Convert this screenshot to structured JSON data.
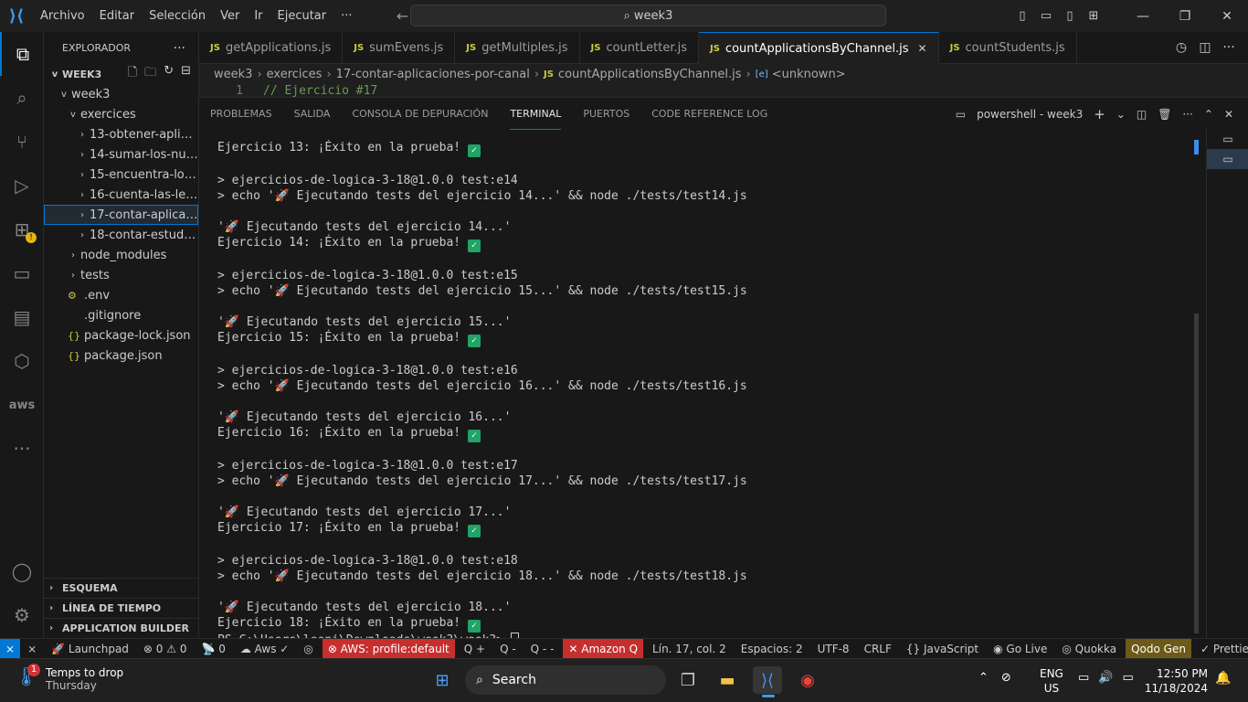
{
  "window": {
    "search_text": "week3"
  },
  "menu": [
    "Archivo",
    "Editar",
    "Selección",
    "Ver",
    "Ir",
    "Ejecutar",
    "···"
  ],
  "sidebar": {
    "title": "EXPLORADOR",
    "root": "WEEK3",
    "items": [
      {
        "label": "week3",
        "indent": 1,
        "chevron": "v"
      },
      {
        "label": "exercices",
        "indent": 2,
        "chevron": "v"
      },
      {
        "label": "13-obtener-aplicac...",
        "indent": 3,
        "chevron": ">"
      },
      {
        "label": "14-sumar-los-num...",
        "indent": 3,
        "chevron": ">"
      },
      {
        "label": "15-encuentra-los-...",
        "indent": 3,
        "chevron": ">"
      },
      {
        "label": "16-cuenta-las-letras",
        "indent": 3,
        "chevron": ">"
      },
      {
        "label": "17-contar-aplicaci...",
        "indent": 3,
        "chevron": ">",
        "selected": true
      },
      {
        "label": "18-contar-estudian...",
        "indent": 3,
        "chevron": ">"
      },
      {
        "label": "node_modules",
        "indent": 2,
        "chevron": ">"
      },
      {
        "label": "tests",
        "indent": 2,
        "chevron": ">"
      },
      {
        "label": ".env",
        "indent": 2,
        "chevron": "",
        "icon": "⚙"
      },
      {
        "label": ".gitignore",
        "indent": 2,
        "chevron": "",
        "icon": ""
      },
      {
        "label": "package-lock.json",
        "indent": 2,
        "chevron": "",
        "icon": "{}"
      },
      {
        "label": "package.json",
        "indent": 2,
        "chevron": "",
        "icon": "{}"
      }
    ],
    "sections": [
      "ESQUEMA",
      "LÍNEA DE TIEMPO",
      "APPLICATION BUILDER"
    ]
  },
  "tabs": [
    {
      "label": "getApplications.js"
    },
    {
      "label": "sumEvens.js"
    },
    {
      "label": "getMultiples.js"
    },
    {
      "label": "countLetter.js"
    },
    {
      "label": "countApplicationsByChannel.js",
      "active": true
    },
    {
      "label": "countStudents.js"
    }
  ],
  "breadcrumb": [
    "week3",
    "exercices",
    "17-contar-aplicaciones-por-canal",
    "countApplicationsByChannel.js",
    "<unknown>"
  ],
  "editor": {
    "line_number": "1",
    "line_text": "// Ejercicio #17"
  },
  "panel": {
    "tabs": [
      "PROBLEMAS",
      "SALIDA",
      "CONSOLA DE DEPURACIÓN",
      "TERMINAL",
      "PUERTOS",
      "CODE REFERENCE LOG"
    ],
    "active_tab": "TERMINAL",
    "terminal_name": "powershell - week3"
  },
  "terminal": {
    "lines": [
      {
        "text": "Ejercicio 13: ¡Éxito en la prueba! ",
        "check": true
      },
      {
        "text": ""
      },
      {
        "text": "> ejercicios-de-logica-3-18@1.0.0 test:e14"
      },
      {
        "text": "> echo '🚀 Ejecutando tests del ejercicio 14...' && node ./tests/test14.js"
      },
      {
        "text": ""
      },
      {
        "text": "'🚀 Ejecutando tests del ejercicio 14...'"
      },
      {
        "text": "Ejercicio 14: ¡Éxito en la prueba! ",
        "check": true
      },
      {
        "text": ""
      },
      {
        "text": "> ejercicios-de-logica-3-18@1.0.0 test:e15"
      },
      {
        "text": "> echo '🚀 Ejecutando tests del ejercicio 15...' && node ./tests/test15.js"
      },
      {
        "text": ""
      },
      {
        "text": "'🚀 Ejecutando tests del ejercicio 15...'"
      },
      {
        "text": "Ejercicio 15: ¡Éxito en la prueba! ",
        "check": true
      },
      {
        "text": ""
      },
      {
        "text": "> ejercicios-de-logica-3-18@1.0.0 test:e16"
      },
      {
        "text": "> echo '🚀 Ejecutando tests del ejercicio 16...' && node ./tests/test16.js"
      },
      {
        "text": ""
      },
      {
        "text": "'🚀 Ejecutando tests del ejercicio 16...'"
      },
      {
        "text": "Ejercicio 16: ¡Éxito en la prueba! ",
        "check": true
      },
      {
        "text": ""
      },
      {
        "text": "> ejercicios-de-logica-3-18@1.0.0 test:e17"
      },
      {
        "text": "> echo '🚀 Ejecutando tests del ejercicio 17...' && node ./tests/test17.js"
      },
      {
        "text": ""
      },
      {
        "text": "'🚀 Ejecutando tests del ejercicio 17...'"
      },
      {
        "text": "Ejercicio 17: ¡Éxito en la prueba! ",
        "check": true
      },
      {
        "text": ""
      },
      {
        "text": "> ejercicios-de-logica-3-18@1.0.0 test:e18"
      },
      {
        "text": "> echo '🚀 Ejecutando tests del ejercicio 18...' && node ./tests/test18.js"
      },
      {
        "text": ""
      },
      {
        "text": "'🚀 Ejecutando tests del ejercicio 18...'"
      },
      {
        "text": "Ejercicio 18: ¡Éxito en la prueba! ",
        "check": true
      }
    ],
    "prompt": "PS C:\\Users\\leoni\\Downloads\\week3\\week3> "
  },
  "statusbar": {
    "left": [
      {
        "label": "⨯"
      },
      {
        "label": "🚀 Launchpad"
      },
      {
        "label": "⊗ 0 ⚠ 0"
      },
      {
        "label": "📡 0"
      },
      {
        "label": "☁ Aws ✓"
      },
      {
        "label": "◎"
      },
      {
        "label": "⊗ AWS: profile:default",
        "bg": "#c72e2e"
      },
      {
        "label": "Q +"
      },
      {
        "label": "Q -"
      },
      {
        "label": "Q - -"
      },
      {
        "label": "✕ Amazon Q",
        "bg": "#c72e2e"
      }
    ],
    "right": [
      {
        "label": "Lín. 17, col. 2"
      },
      {
        "label": "Espacios: 2"
      },
      {
        "label": "UTF-8"
      },
      {
        "label": "CRLF"
      },
      {
        "label": "{} JavaScript"
      },
      {
        "label": "◉ Go Live"
      },
      {
        "label": "◎ Quokka"
      },
      {
        "label": "Qodo Gen",
        "bg": "#6b5a18"
      },
      {
        "label": "✓ Prettier"
      },
      {
        "label": "🔔"
      }
    ]
  },
  "taskbar": {
    "weather_title": "Temps to drop",
    "weather_sub": "Thursday",
    "weather_badge": "1",
    "search_label": "Search",
    "lang": "ENG",
    "region": "US",
    "time": "12:50 PM",
    "date": "11/18/2024"
  },
  "colors": {
    "accent": "#0078d4",
    "error_bg": "#c72e2e",
    "check_green": "#21a366"
  }
}
